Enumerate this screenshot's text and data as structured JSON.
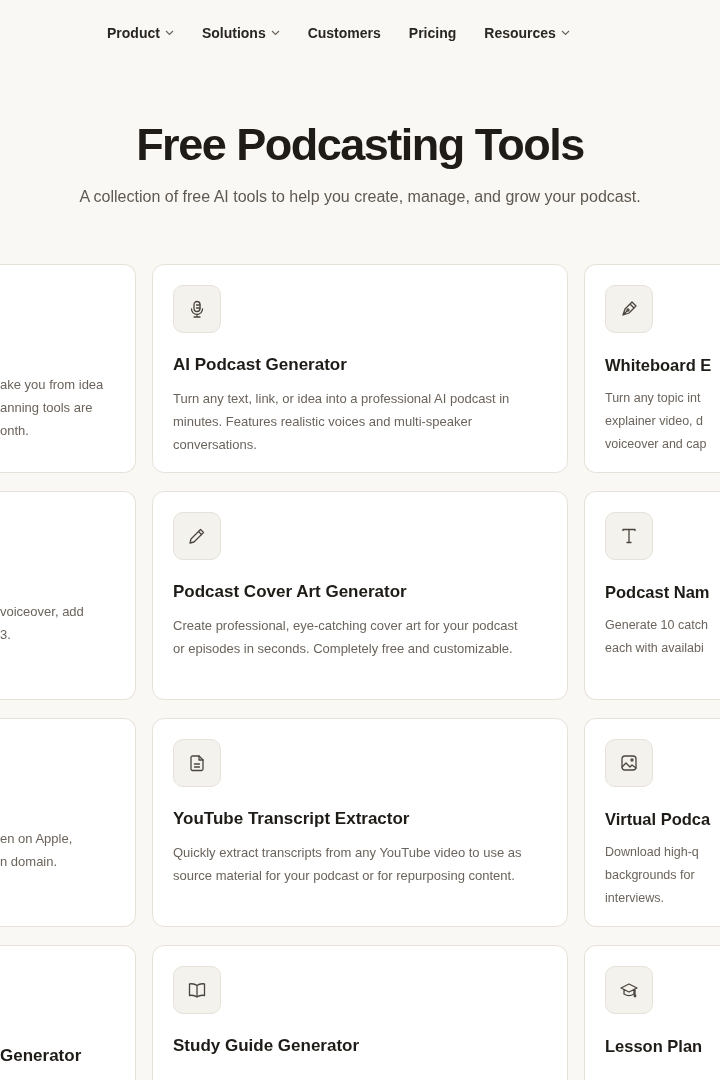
{
  "nav": [
    {
      "label": "Product",
      "dropdown": true
    },
    {
      "label": "Solutions",
      "dropdown": true
    },
    {
      "label": "Customers",
      "dropdown": false
    },
    {
      "label": "Pricing",
      "dropdown": false
    },
    {
      "label": "Resources",
      "dropdown": true
    }
  ],
  "hero": {
    "title": "Free Podcasting Tools",
    "subtitle": "A collection of free AI tools to help you create, manage, and grow your podcast."
  },
  "rows": [
    {
      "left": {
        "lines": [
          "ake you from idea",
          "anning tools are",
          "onth."
        ]
      },
      "center": {
        "kind": "mic",
        "title": "AI Podcast Generator",
        "description": "Turn any text, link, or idea into a professional AI podcast in minutes. Features realistic voices and multi-speaker conversations."
      },
      "right": {
        "kind": "pen",
        "title": "Whiteboard E",
        "lines": [
          "Turn any topic int",
          "explainer video, d",
          "voiceover and cap"
        ]
      }
    },
    {
      "left": {
        "lines": [
          "voiceover, add",
          "3."
        ]
      },
      "center": {
        "kind": "pencil",
        "title": "Podcast Cover Art Generator",
        "description": "Create professional, eye-catching cover art for your podcast or episodes in seconds. Completely free and customizable."
      },
      "right": {
        "kind": "text",
        "title": "Podcast Nam",
        "lines": [
          "Generate 10 catch",
          "each with availabi"
        ]
      }
    },
    {
      "left": {
        "lines": [
          "en on Apple,",
          "n domain."
        ]
      },
      "center": {
        "kind": "document",
        "title": "YouTube Transcript Extractor",
        "description": "Quickly extract transcripts from any YouTube video to use as source material for your podcast or for repurposing content."
      },
      "right": {
        "kind": "image",
        "title": "Virtual Podca",
        "lines": [
          "Download high-q",
          "backgrounds for",
          "interviews."
        ]
      }
    },
    {
      "left": {
        "title": "Generator"
      },
      "center": {
        "kind": "book",
        "title": "Study Guide Generator"
      },
      "right": {
        "kind": "cap",
        "title": "Lesson Plan"
      }
    }
  ]
}
